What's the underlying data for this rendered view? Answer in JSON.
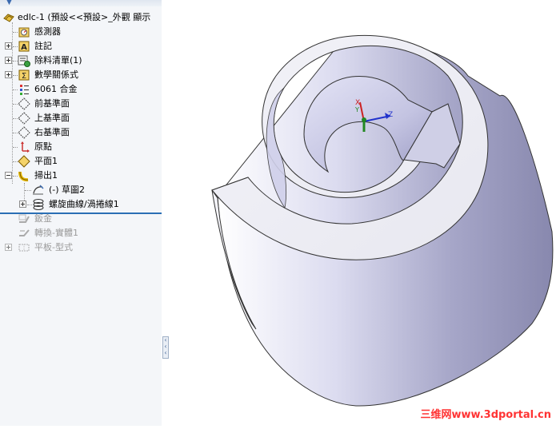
{
  "tree": {
    "root_label": "edlc-1  (預設<<預設>_外觀 顯示",
    "items": [
      {
        "label": "感測器"
      },
      {
        "label": "註記"
      },
      {
        "label": "除料清單(1)"
      },
      {
        "label": "數學關係式"
      },
      {
        "label": "6061 合金"
      },
      {
        "label": "前基準面"
      },
      {
        "label": "上基準面"
      },
      {
        "label": "右基準面"
      },
      {
        "label": "原點"
      },
      {
        "label": "平面1"
      },
      {
        "label": "掃出1"
      },
      {
        "label": "(-) 草圖2"
      },
      {
        "label": "螺旋曲線/渦捲線1"
      },
      {
        "label": "鈑金"
      },
      {
        "label": "轉換-實體1"
      },
      {
        "label": "平板-型式"
      }
    ]
  },
  "viewport": {
    "triad": {
      "x_label": "X",
      "y_label": "Y",
      "z_label": "Z"
    }
  },
  "watermark": "三维网www.3dportal.cn",
  "colors": {
    "panel_bg": "#f4f6f9",
    "rollback_bar": "#2a6fb5",
    "model_light": "#eeeef8",
    "model_dark": "#8a8ab0",
    "watermark": "#ff3333"
  }
}
